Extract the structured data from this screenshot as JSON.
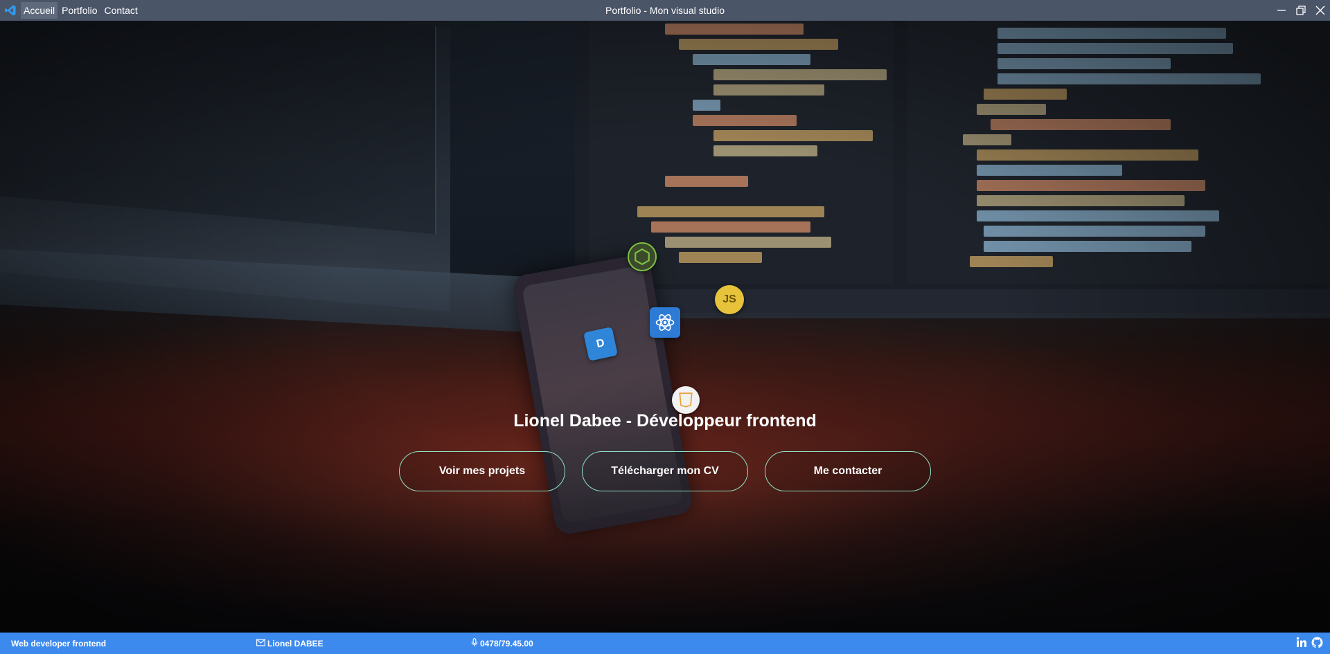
{
  "titlebar": {
    "menu": [
      {
        "label": "Accueil",
        "active": true
      },
      {
        "label": "Portfolio",
        "active": false
      },
      {
        "label": "Contact",
        "active": false
      }
    ],
    "title": "Portfolio - Mon visual studio",
    "controls": [
      "minimize-icon",
      "restore-icon",
      "close-icon"
    ]
  },
  "hero": {
    "title": "Lionel Dabee - Développeur frontend",
    "buttons": [
      {
        "label": "Voir mes projets"
      },
      {
        "label": "Télécharger mon CV"
      },
      {
        "label": "Me contacter"
      }
    ],
    "tech_icons": [
      "nodejs-icon",
      "js-icon",
      "react-icon",
      "typescript-icon",
      "css-icon"
    ],
    "accent_color": "#8fe3c8"
  },
  "footer": {
    "role": "Web developer frontend",
    "name": "Lionel DABEE",
    "phone": "0478/79.45.00",
    "social_icons": [
      "linkedin-icon",
      "github-icon"
    ],
    "background_color": "#3d8aee"
  }
}
